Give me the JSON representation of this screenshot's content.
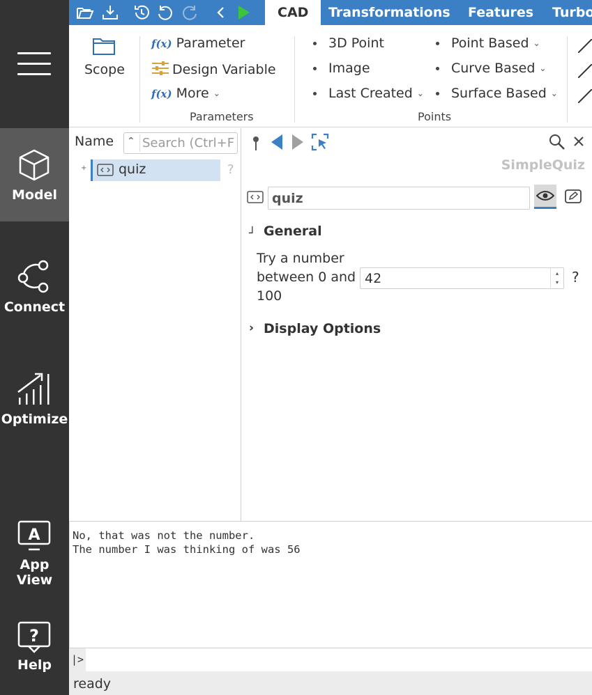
{
  "nav": {
    "items": [
      {
        "label": "Model",
        "icon": "cube-icon"
      },
      {
        "label": "Connect",
        "icon": "connect-icon"
      },
      {
        "label": "Optimize",
        "icon": "optimize-icon"
      },
      {
        "label": "App View",
        "icon": "app-view-icon"
      },
      {
        "label": "Help",
        "icon": "help-icon"
      }
    ],
    "active": "Model"
  },
  "toolbar": {
    "quick_access": [
      "open-folder-icon",
      "download-icon",
      "history-icon",
      "undo-icon",
      "redo-icon",
      "back-icon",
      "run-icon"
    ],
    "tabs": [
      "CAD",
      "Transformations",
      "Features",
      "Turbo"
    ],
    "active_tab": "CAD",
    "accent_color": "#3b7fc4"
  },
  "ribbon": {
    "scope_label": "Scope",
    "parameters": {
      "items": [
        "Parameter",
        "Design Variable",
        "More"
      ],
      "group_label": "Parameters"
    },
    "points": {
      "col1": [
        "3D Point",
        "Image",
        "Last Created"
      ],
      "col2": [
        "Point Based",
        "Curve Based",
        "Surface Based"
      ],
      "group_label": "Points"
    }
  },
  "tree": {
    "header": "Name",
    "search_placeholder": "Search (Ctrl+F)",
    "items": [
      {
        "label": "quiz",
        "help": "?"
      }
    ]
  },
  "props": {
    "title": "SimpleQuiz",
    "name_value": "quiz",
    "general_header": "General",
    "field_label": "Try a number between 0 and 100",
    "field_value": "42",
    "field_help": "?",
    "display_options_header": "Display Options"
  },
  "console": {
    "lines": [
      "No, that was not the number.",
      "The number I was thinking of was 56"
    ],
    "prompt": "|>"
  },
  "status": "ready"
}
